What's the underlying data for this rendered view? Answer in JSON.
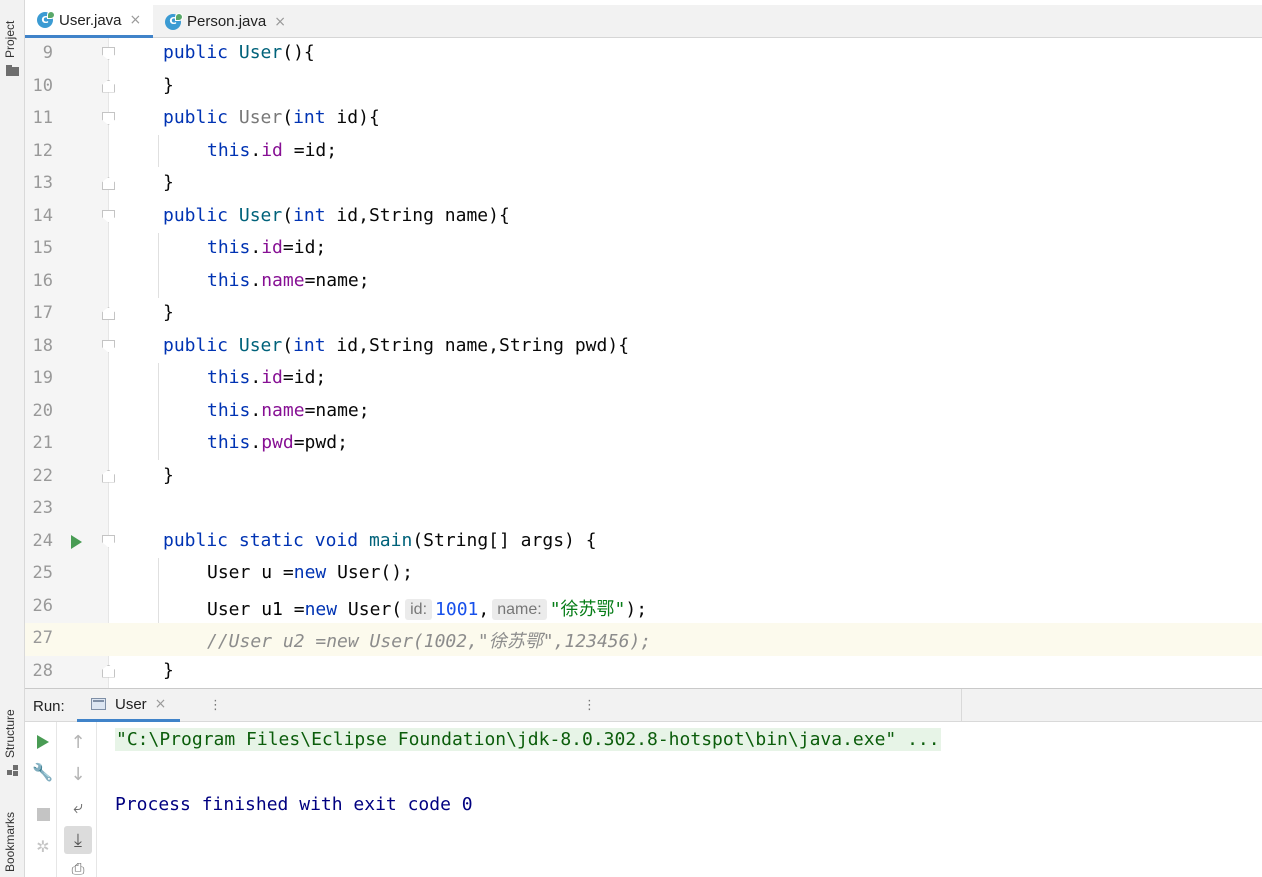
{
  "tool_strip": {
    "project_label": "Project",
    "structure_label": "Structure",
    "bookmarks_label": "Bookmarks"
  },
  "tabs": [
    {
      "label": "User.java",
      "icon": "java-class-icon",
      "active": true
    },
    {
      "label": "Person.java",
      "icon": "java-class-icon",
      "active": false
    }
  ],
  "icons": {
    "tab_close": "×",
    "class_letter": "C",
    "kebab": "⋮"
  },
  "editor": {
    "current_line": 27,
    "lines": [
      {
        "n": "9"
      },
      {
        "n": "10"
      },
      {
        "n": "11"
      },
      {
        "n": "12"
      },
      {
        "n": "13"
      },
      {
        "n": "14"
      },
      {
        "n": "15"
      },
      {
        "n": "16"
      },
      {
        "n": "17"
      },
      {
        "n": "18"
      },
      {
        "n": "19"
      },
      {
        "n": "20"
      },
      {
        "n": "21"
      },
      {
        "n": "22"
      },
      {
        "n": "23"
      },
      {
        "n": "24"
      },
      {
        "n": "25"
      },
      {
        "n": "26"
      },
      {
        "n": "27"
      },
      {
        "n": "28"
      }
    ],
    "code": {
      "l9_kw": "public",
      "l9_name": "User",
      "l9_rest": "(){",
      "l10": "}",
      "l11_kw": "public",
      "l11_name": "User",
      "l11_p1": "(",
      "l11_int": "int",
      "l11_rest": " id){",
      "l12_this": "this",
      "l12_dot": ".",
      "l12_fld": "id",
      "l12_rest": " =id;",
      "l13": "}",
      "l14_kw": "public",
      "l14_name": "User",
      "l14_p1": "(",
      "l14_int": "int",
      "l14_rest": " id,String name){",
      "l15_this": "this",
      "l15_dot": ".",
      "l15_fld": "id",
      "l15_rest": "=id;",
      "l16_this": "this",
      "l16_dot": ".",
      "l16_fld": "name",
      "l16_rest": "=name;",
      "l17": "}",
      "l18_kw": "public",
      "l18_name": "User",
      "l18_p1": "(",
      "l18_int": "int",
      "l18_rest": " id,String name,String pwd){",
      "l19_this": "this",
      "l19_dot": ".",
      "l19_fld": "id",
      "l19_rest": "=id;",
      "l20_this": "this",
      "l20_dot": ".",
      "l20_fld": "name",
      "l20_rest": "=name;",
      "l21_this": "this",
      "l21_dot": ".",
      "l21_fld": "pwd",
      "l21_rest": "=pwd;",
      "l22": "}",
      "l24_kw1": "public",
      "l24_kw2": "static",
      "l24_kw3": "void",
      "l24_fn": "main",
      "l24_rest": "(String[] args) {",
      "l25_type": "User",
      "l25_var": "u",
      "l25_eq": " =",
      "l25_new": "new",
      "l25_rest": " User();",
      "l26_type": "User",
      "l26_var": "u1",
      "l26_eq": " =",
      "l26_new": "new",
      "l26_call": " User(",
      "l26_hint_id": "id:",
      "l26_num": "1001",
      "l26_comma": ",",
      "l26_hint_name": "name:",
      "l26_str": "\"徐苏鄂\"",
      "l26_end": ");",
      "l27_comment": "//User u2 =new User(1002,\"徐苏鄂\",123456);",
      "l28": "}"
    }
  },
  "run": {
    "label": "Run:",
    "tab_label": "User",
    "command_line": "\"C:\\Program Files\\Eclipse Foundation\\jdk-8.0.302.8-hotspot\\bin\\java.exe\" ...",
    "exit_message": "Process finished with exit code 0"
  },
  "toolbar_glyphs": {
    "wrench": "🔧",
    "bug": "✲",
    "up": "↑",
    "down": "↓",
    "wrap": "⤶",
    "scroll": "⤓",
    "print": "⎙"
  },
  "colors": {
    "keyword": "#0033b3",
    "method": "#00627a",
    "field": "#871094",
    "number": "#1750eb",
    "string": "#067d17",
    "comment": "#8c8c8c",
    "run_green": "#499c54",
    "tab_underline": "#4083c9"
  }
}
